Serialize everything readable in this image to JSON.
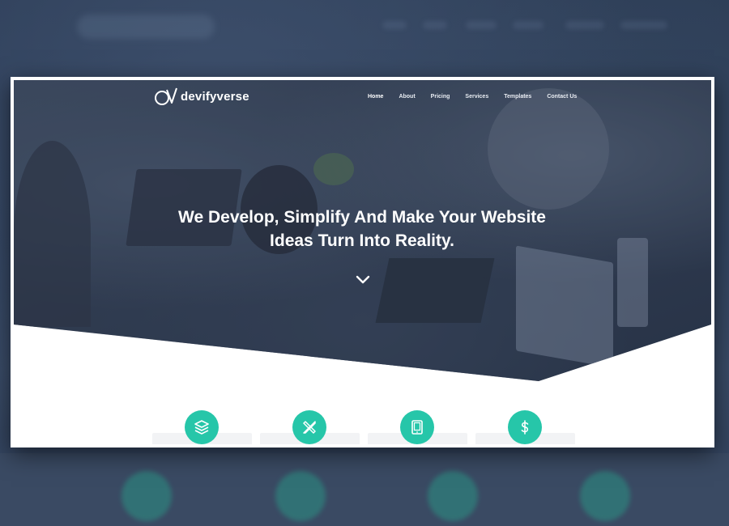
{
  "site": {
    "brand_name": "devifyverse",
    "accent_color": "#26c6a9"
  },
  "nav": {
    "items": [
      {
        "label": "Home",
        "active": true
      },
      {
        "label": "About",
        "active": false
      },
      {
        "label": "Pricing",
        "active": false
      },
      {
        "label": "Services",
        "active": false
      },
      {
        "label": "Templates",
        "active": false
      },
      {
        "label": "Contact Us",
        "active": false
      }
    ]
  },
  "hero": {
    "headline_line1": "We Develop, Simplify And Make Your Website",
    "headline_line2": "Ideas Turn Into Reality.",
    "scroll_icon": "chevron-down-icon"
  },
  "features": [
    {
      "icon": "layers-icon"
    },
    {
      "icon": "tools-icon"
    },
    {
      "icon": "tablet-icon"
    },
    {
      "icon": "dollar-icon"
    }
  ]
}
